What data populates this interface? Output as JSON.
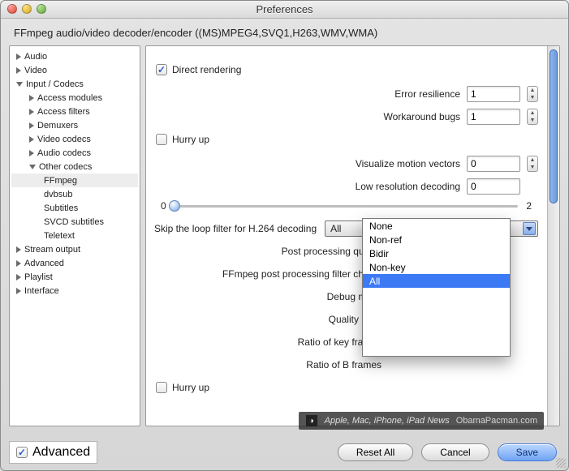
{
  "window": {
    "title": "Preferences"
  },
  "subtitle": "FFmpeg audio/video decoder/encoder ((MS)MPEG4,SVQ1,H263,WMV,WMA)",
  "sidebar": {
    "audio": "Audio",
    "video": "Video",
    "input_codecs": "Input / Codecs",
    "access_modules": "Access modules",
    "access_filters": "Access filters",
    "demuxers": "Demuxers",
    "video_codecs": "Video codecs",
    "audio_codecs": "Audio codecs",
    "other_codecs": "Other codecs",
    "ffmpeg": "FFmpeg",
    "dvbsub": "dvbsub",
    "subtitles": "Subtitles",
    "svcd_subtitles": "SVCD subtitles",
    "teletext": "Teletext",
    "stream_output": "Stream output",
    "advanced": "Advanced",
    "playlist": "Playlist",
    "interface": "Interface"
  },
  "form": {
    "direct_rendering": "Direct rendering",
    "error_resilience": {
      "label": "Error resilience",
      "value": "1"
    },
    "workaround_bugs": {
      "label": "Workaround bugs",
      "value": "1"
    },
    "hurry_up": "Hurry up",
    "visualize_motion": {
      "label": "Visualize motion vectors",
      "value": "0"
    },
    "low_res": {
      "label": "Low resolution decoding",
      "value": "0"
    },
    "slider": {
      "min": "0",
      "max": "2"
    },
    "skip_loop": {
      "label": "Skip the loop filter for H.264 decoding",
      "value": "All"
    },
    "post_quality": "Post processing quality",
    "filter_chains": "FFmpeg post processing filter chains",
    "debug_mask": "Debug mask",
    "quality_level": "Quality level",
    "ratio_key": "Ratio of key frames",
    "ratio_b": "Ratio of B frames",
    "hurry_up2": "Hurry up",
    "dropdown_options": [
      "None",
      "Non-ref",
      "Bidir",
      "Non-key",
      "All"
    ]
  },
  "footer": {
    "advanced": "Advanced",
    "reset": "Reset All",
    "cancel": "Cancel",
    "save": "Save"
  },
  "watermark": {
    "text": "Apple, Mac, iPhone, iPad News",
    "site": "ObamaPacman.com"
  }
}
